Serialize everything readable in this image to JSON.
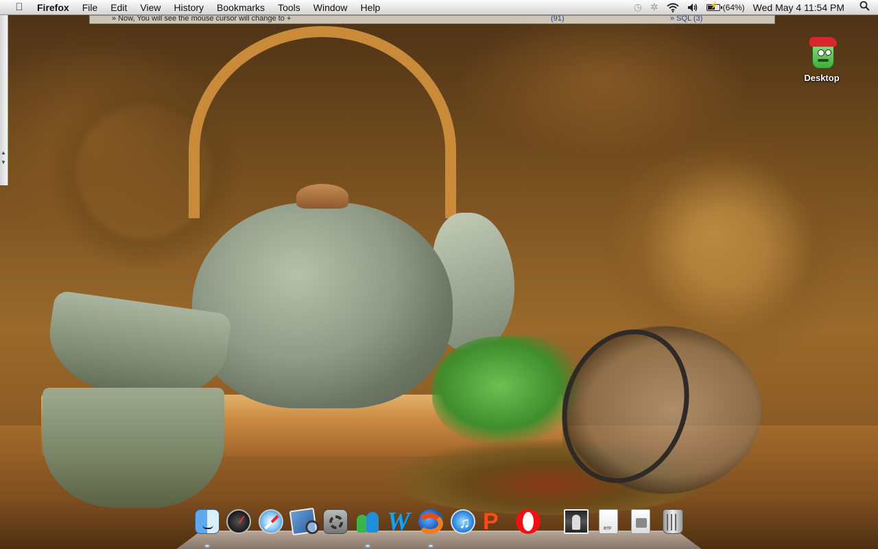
{
  "menubar": {
    "apple_icon": "apple-icon",
    "app_name": "Firefox",
    "menus": [
      "File",
      "Edit",
      "View",
      "History",
      "Bookmarks",
      "Tools",
      "Window",
      "Help"
    ],
    "status": {
      "time_machine_icon": "time-machine-icon",
      "bluetooth_icon": "bluetooth-icon",
      "wifi_icon": "wifi-icon",
      "volume_icon": "volume-icon",
      "battery_icon": "battery-charging-icon",
      "battery_percent_text": "(64%)",
      "battery_level": 0.64,
      "clock": "Wed May 4  11:54 PM",
      "spotlight_icon": "spotlight-search-icon"
    }
  },
  "browser_strip": {
    "text": "» Now, You will see the mouse cursor will change to +",
    "link_1": "(91)",
    "link_2": "» SQL (3)"
  },
  "desktop": {
    "icon_label": "Desktop",
    "icon_name": "monster-folder-icon"
  },
  "dock": {
    "items": [
      {
        "name": "finder-icon",
        "running": true
      },
      {
        "name": "dashboard-icon",
        "running": false
      },
      {
        "name": "safari-icon",
        "running": false
      },
      {
        "name": "preview-icon",
        "running": false
      },
      {
        "name": "system-preferences-icon",
        "running": false
      },
      {
        "name": "messenger-icon",
        "running": true
      },
      {
        "name": "word-icon",
        "running": false
      },
      {
        "name": "firefox-icon",
        "running": true
      },
      {
        "name": "itunes-icon",
        "running": false
      },
      {
        "name": "app-red-icon",
        "running": false
      },
      {
        "name": "opera-icon",
        "running": false
      },
      {
        "name": "photo-icon",
        "running": false
      },
      {
        "name": "rtf-document-icon",
        "running": false
      },
      {
        "name": "document-icon",
        "running": false
      },
      {
        "name": "trash-icon",
        "running": false
      }
    ],
    "labels": {
      "word_letter": "W",
      "itunes_note": "♫",
      "red_app_letter": "P",
      "rtf_badge": "RTF"
    }
  }
}
